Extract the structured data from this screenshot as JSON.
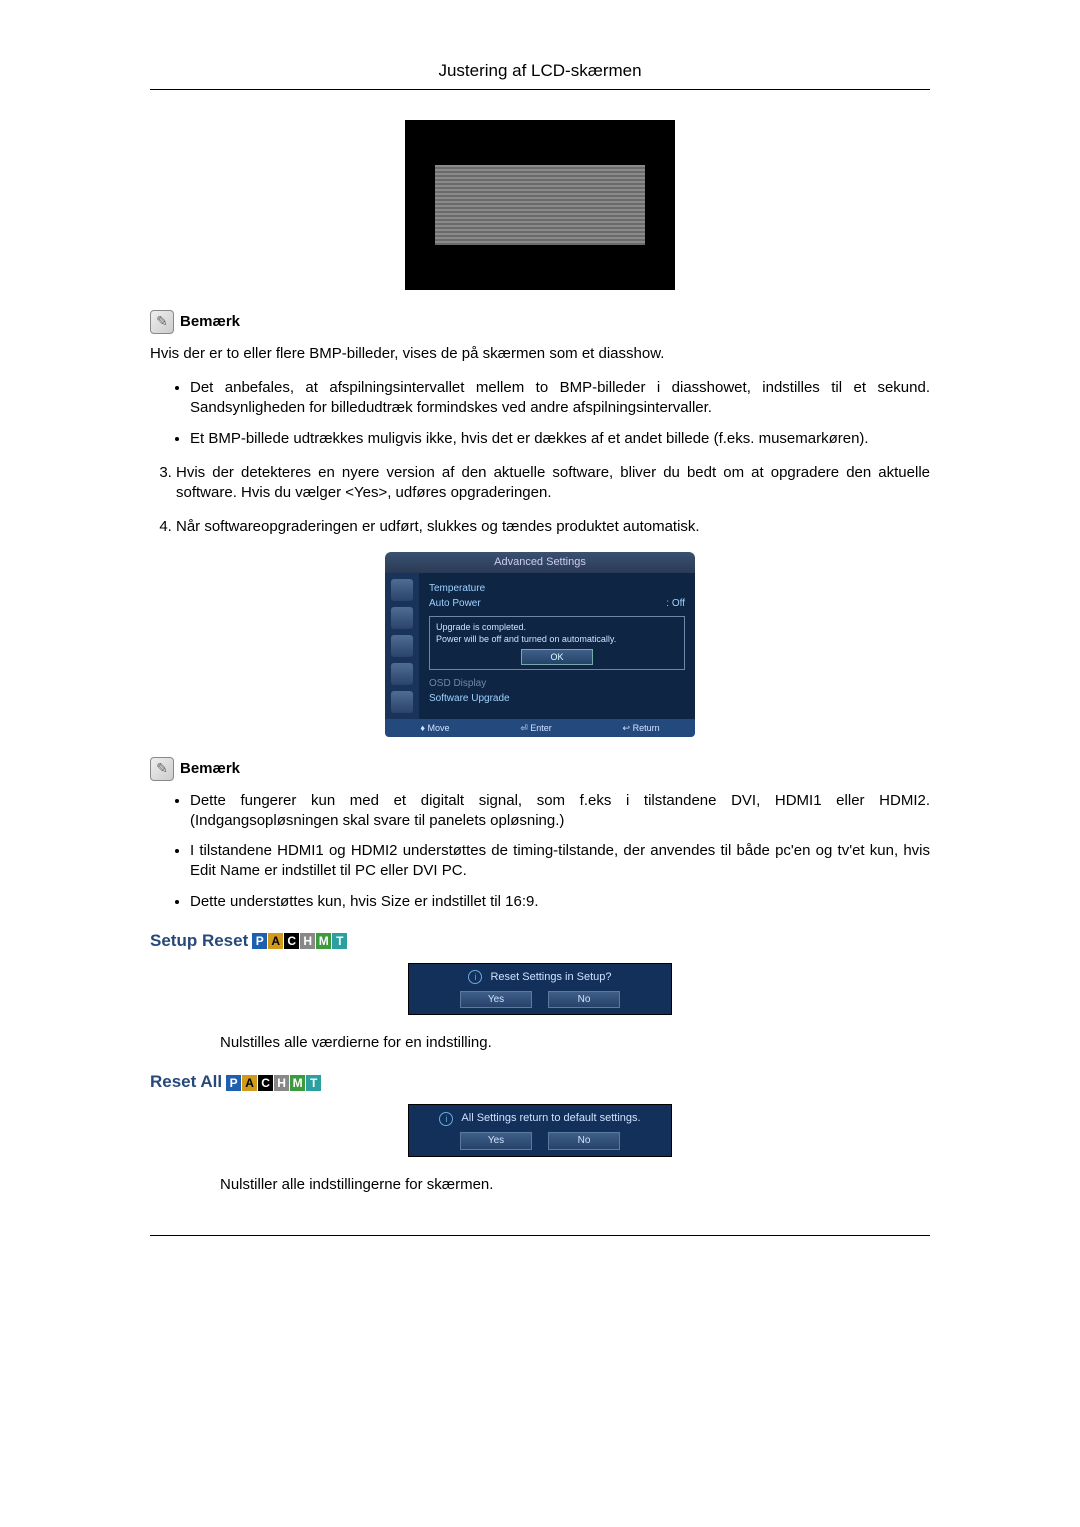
{
  "header": {
    "title": "Justering af LCD-skærmen"
  },
  "note1": {
    "label": "Bemærk",
    "intro": "Hvis der er to eller flere BMP-billeder, vises de på skærmen som et diasshow.",
    "bullets": [
      "Det anbefales, at afspilningsintervallet mellem to BMP-billeder i diasshowet, indstilles til et sekund. Sandsynligheden for billedudtræk formindskes ved andre afspilningsintervaller.",
      "Et BMP-billede udtrækkes muligvis ikke, hvis det er dækkes af et andet billede (f.eks. musemarkøren)."
    ]
  },
  "steps": {
    "s3": "Hvis der detekteres en nyere version af den aktuelle software, bliver du bedt om at opgradere den aktuelle software. Hvis du vælger <Yes>, udføres opgraderingen.",
    "s4": "Når softwareopgraderingen er udført, slukkes og tændes produktet automatisk."
  },
  "osd": {
    "title": "Advanced Settings",
    "rows": {
      "temperature": "Temperature",
      "autopower_label": "Auto Power",
      "autopower_value": ": Off",
      "osddisplay": "OSD Display",
      "softwareupgrade": "Software Upgrade"
    },
    "msg1": "Upgrade is completed.",
    "msg2": "Power will be off and turned on automatically.",
    "ok": "OK",
    "footer": {
      "move": "♦ Move",
      "enter": "⏎ Enter",
      "return": "↩ Return"
    }
  },
  "note2": {
    "label": "Bemærk",
    "bullets": [
      "Dette fungerer kun med et digitalt signal, som f.eks i tilstandene DVI, HDMI1 eller HDMI2. (Indgangsopløsningen skal svare til panelets opløsning.)",
      "I tilstandene HDMI1 og HDMI2 understøttes de timing-tilstande, der anvendes til både pc'en og tv'et kun, hvis Edit Name er indstillet til PC eller DVI PC.",
      "Dette understøttes kun, hvis Size er indstillet til 16:9."
    ]
  },
  "badges": {
    "p": "P",
    "a": "A",
    "c": "C",
    "h": "H",
    "m": "M",
    "t": "T"
  },
  "setup_reset": {
    "heading": "Setup Reset",
    "dialog_text": "Reset Settings in Setup?",
    "yes": "Yes",
    "no": "No",
    "desc": "Nulstilles alle værdierne for en indstilling."
  },
  "reset_all": {
    "heading": "Reset All",
    "dialog_text": "All Settings return to default settings.",
    "yes": "Yes",
    "no": "No",
    "desc": "Nulstiller alle indstillingerne for skærmen."
  }
}
